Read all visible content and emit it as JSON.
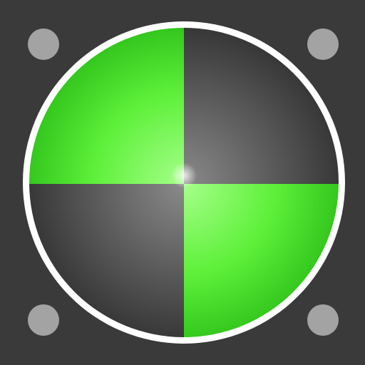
{
  "icon": {
    "name": "calibration-target",
    "colors": {
      "background": "#3b3a3b",
      "ring": "#ffffff",
      "screw": "#a3a3a3",
      "green_light": "#a6ff8a",
      "green_mid": "#5ef03a",
      "green_dark": "#2fc21a",
      "gray_light": "#8a8a8a",
      "gray_dark": "#333333"
    }
  }
}
